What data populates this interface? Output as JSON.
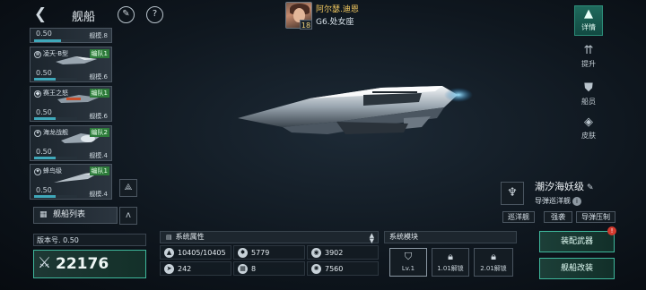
{
  "header": {
    "back_icon": "back-chevron-icon",
    "title": "舰船",
    "rename_icon": "pen-icon",
    "help_icon": "question-icon"
  },
  "commander": {
    "name": "阿尔瑟.迪恩",
    "location": "G6.处女座",
    "level": "18"
  },
  "right_tabs": [
    {
      "label": "详情",
      "icon": "ship-class-icon",
      "active": true
    },
    {
      "label": "提升",
      "icon": "upgrade-arrows-icon",
      "active": false
    },
    {
      "label": "船员",
      "icon": "crew-icon",
      "active": false
    },
    {
      "label": "皮肤",
      "icon": "skin-icon",
      "active": false
    }
  ],
  "ship_list": [
    {
      "name": "",
      "fleet": "",
      "progress": "0.50",
      "size": "舰模.8",
      "progress_fraction": 0.5
    },
    {
      "name": "凌天·B型",
      "fleet": "编队1",
      "progress": "0.50",
      "size": "舰模.6",
      "progress_fraction": 0.5
    },
    {
      "name": "赛王之怒",
      "fleet": "编队1",
      "progress": "0.50",
      "size": "舰模.6",
      "progress_fraction": 0.5
    },
    {
      "name": "海龙战舰",
      "fleet": "编队2",
      "progress": "0.50",
      "size": "舰模.4",
      "progress_fraction": 0.5
    },
    {
      "name": "蜂鸟级",
      "fleet": "编队1",
      "progress": "0.50",
      "size": "舰模.4",
      "progress_fraction": 0.5
    }
  ],
  "ship_list_button": "舰船列表",
  "version_label": "版本号. 0.50",
  "power_value": "22176",
  "ship": {
    "class_name": "潮汐海妖级",
    "class_type": "导弹巡洋舰",
    "tags": [
      "巡洋舰",
      "强袭",
      "导弹压制"
    ]
  },
  "attributes": {
    "header": "系统属性",
    "stats": [
      {
        "icon": "hull-icon",
        "value": "10405/10405"
      },
      {
        "icon": "attack-icon",
        "value": "5779"
      },
      {
        "icon": "shield-icon",
        "value": "3902"
      },
      {
        "icon": "speed-icon",
        "value": "242"
      },
      {
        "icon": "armor-icon",
        "value": "8"
      },
      {
        "icon": "energy-icon",
        "value": "7560"
      }
    ]
  },
  "modules": {
    "header": "系统模块",
    "slots": [
      {
        "icon": "module-shield-icon",
        "label": "Lv.1"
      },
      {
        "icon": "lock-icon",
        "label": "1.01解锁"
      },
      {
        "icon": "lock-icon",
        "label": "2.01解锁"
      }
    ]
  },
  "actions": {
    "equip_label": "装配武器",
    "modify_label": "舰船改装",
    "equip_badge": "!"
  },
  "colors": {
    "accent": "#3fb89c",
    "fleet_tag": "#2d7b3a",
    "progress": "#3fa8ba",
    "commander_name": "#f1c75f"
  }
}
